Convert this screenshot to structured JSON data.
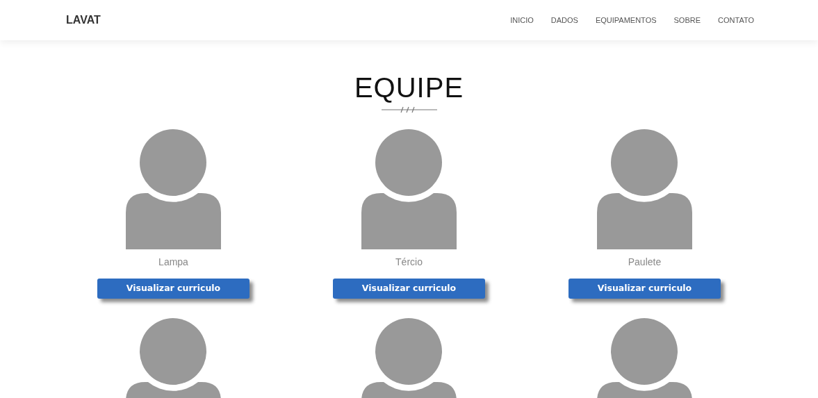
{
  "navbar": {
    "brand": "LAVAT",
    "links": [
      {
        "label": "INICIO"
      },
      {
        "label": "DADOS"
      },
      {
        "label": "EQUIPAMENTOS"
      },
      {
        "label": "SOBRE"
      },
      {
        "label": "CONTATO"
      }
    ]
  },
  "section": {
    "title": "EQUIPE"
  },
  "members": [
    {
      "kind": "full",
      "name": "Lampa",
      "button": "Visualizar curriculo"
    },
    {
      "kind": "full",
      "name": "Tércio",
      "button": "Visualizar curriculo"
    },
    {
      "kind": "full",
      "name": "Paulete",
      "button": "Visualizar curriculo"
    },
    {
      "kind": "cut"
    },
    {
      "kind": "cut"
    },
    {
      "kind": "cut"
    }
  ]
}
